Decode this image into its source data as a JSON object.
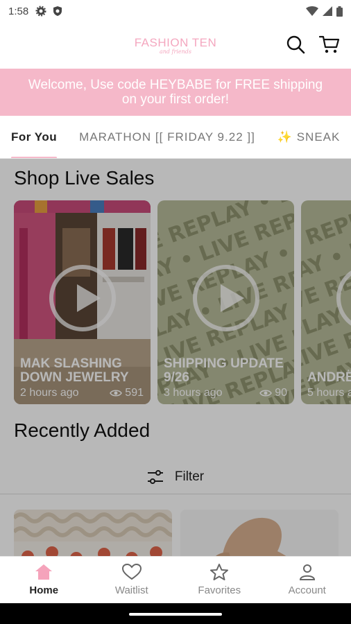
{
  "status_bar": {
    "time": "1:58"
  },
  "header": {
    "brand": "FASHION TEN",
    "brand_sub": "and friends"
  },
  "promo": {
    "line1": "Welcome, Use code HEYBABE for FREE shipping",
    "line2": "on your first order!"
  },
  "tabs": [
    {
      "label": "For You"
    },
    {
      "label": "MARATHON [[ FRIDAY 9.22 ]]"
    },
    {
      "label": "✨ SNEAK"
    }
  ],
  "live_sales": {
    "title": "Shop Live Sales",
    "cards": [
      {
        "title": "MAK SLASHING DOWN JEWELRY",
        "time": "2 hours ago",
        "views": "591"
      },
      {
        "title": "SHIPPING UPDATE 9/26",
        "time": "3 hours ago",
        "views": "90"
      },
      {
        "title": "ANDRË",
        "time": "5 hours a",
        "views": ""
      }
    ]
  },
  "recently_added": {
    "title": "Recently Added",
    "filter_label": "Filter"
  },
  "bottom_nav": [
    {
      "label": "Home",
      "icon": "home-icon"
    },
    {
      "label": "Waitlist",
      "icon": "heart-icon"
    },
    {
      "label": "Favorites",
      "icon": "star-icon"
    },
    {
      "label": "Account",
      "icon": "account-icon"
    }
  ],
  "colors": {
    "accent_pink": "#f5b8c9",
    "logo_pink": "#f4a7bf",
    "overlay": "rgba(0,0,0,0.28)"
  }
}
